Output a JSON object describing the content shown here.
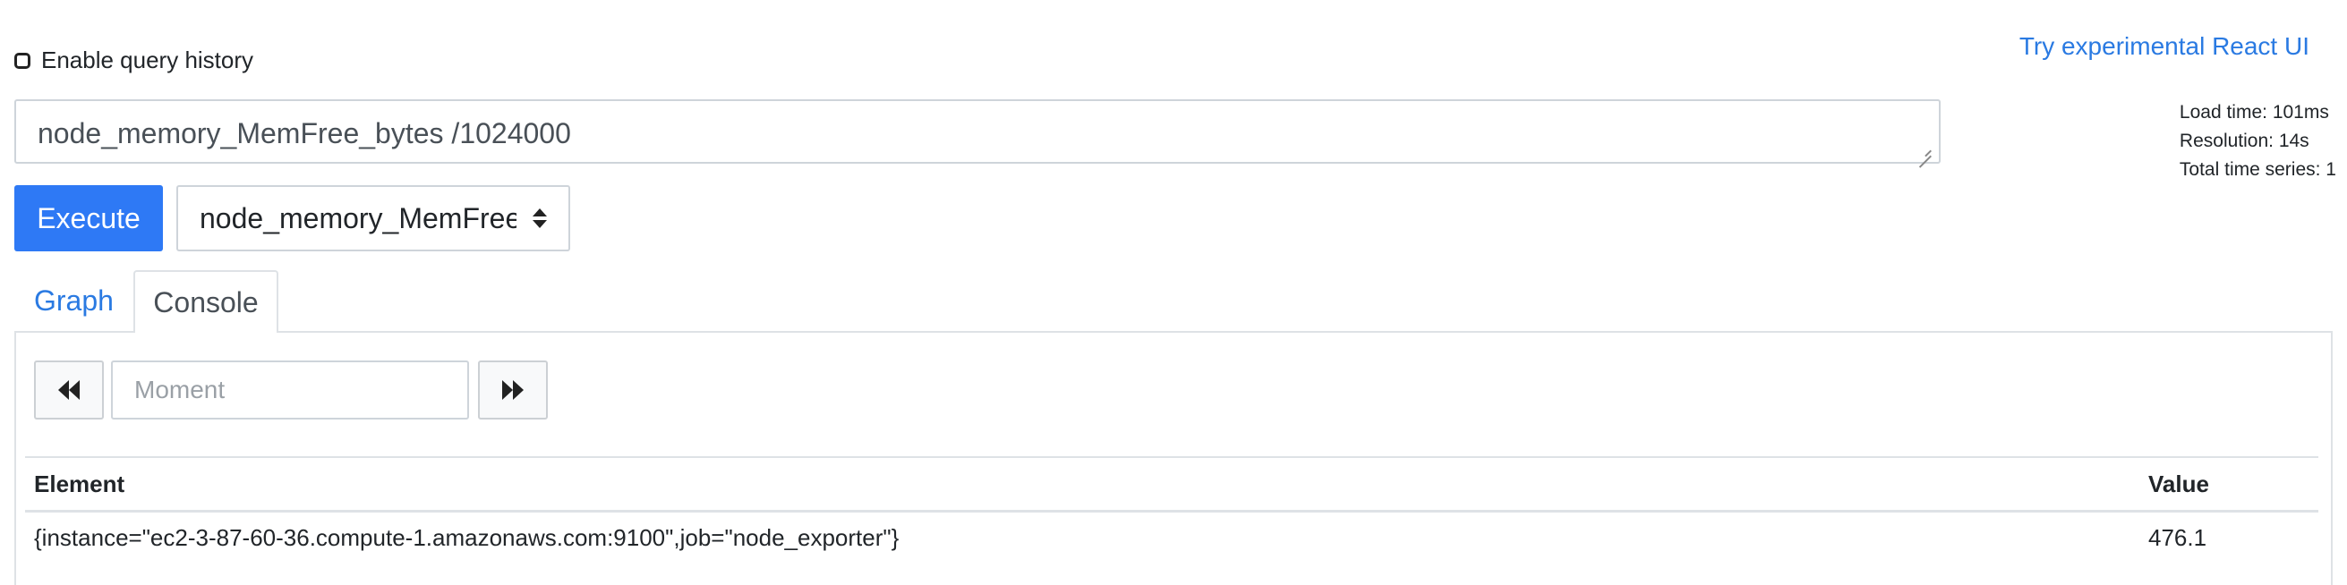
{
  "query_history": {
    "label": "Enable query history",
    "checked": false
  },
  "react_link": {
    "label": "Try experimental React UI"
  },
  "stats": {
    "load_time": "Load time: 101ms",
    "resolution": "Resolution: 14s",
    "total_series": "Total time series: 1"
  },
  "query": {
    "value": "node_memory_MemFree_bytes /1024000"
  },
  "execute": {
    "label": "Execute"
  },
  "metric_select": {
    "selected": "node_memory_MemFree_bytes"
  },
  "tabs": [
    {
      "label": "Graph",
      "active": false
    },
    {
      "label": "Console",
      "active": true
    }
  ],
  "moment": {
    "placeholder": "Moment"
  },
  "table": {
    "headers": {
      "element": "Element",
      "value": "Value"
    },
    "rows": [
      {
        "element": "{instance=\"ec2-3-87-60-36.compute-1.amazonaws.com:9100\",job=\"node_exporter\"}",
        "value": "476.1"
      }
    ]
  },
  "colors": {
    "accent": "#2e79f5",
    "link": "#2a7ae2",
    "border": "#dee2e6"
  }
}
